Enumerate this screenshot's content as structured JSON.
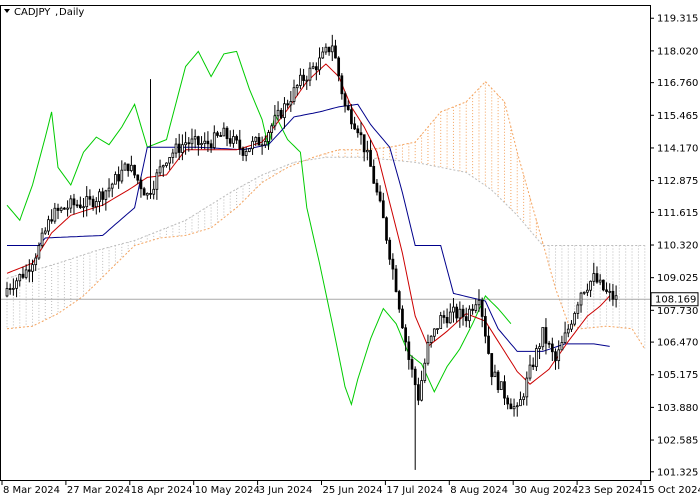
{
  "symbol": "CADJPY",
  "timeframe": "Daily",
  "current_price_label": "108.169",
  "chart_data": {
    "type": "candlestick",
    "symbol": "CADJPY",
    "timeframe": "Daily",
    "indicator": "Ichimoku Kinko Hyo",
    "ylim": [
      101.0,
      119.8
    ],
    "y_ticks": [
      "119.315",
      "118.020",
      "116.760",
      "115.465",
      "114.170",
      "112.875",
      "111.615",
      "110.320",
      "109.025",
      "107.730",
      "106.470",
      "105.175",
      "103.880",
      "102.585",
      "101.325"
    ],
    "y_tick_values": [
      119.315,
      118.02,
      116.76,
      115.465,
      114.17,
      112.875,
      111.615,
      110.32,
      109.025,
      107.73,
      106.47,
      105.175,
      103.88,
      102.585,
      101.325
    ],
    "x_ticks": [
      "8 Mar 2024",
      "27 Mar 2024",
      "18 Apr 2024",
      "10 May 2024",
      "3 Jun 2024",
      "25 Jun 2024",
      "17 Jul 2024",
      "8 Aug 2024",
      "30 Aug 2024",
      "23 Sep 2024",
      "15 Oct 2024"
    ],
    "current_price": 108.169,
    "series": [
      {
        "name": "Price",
        "color": "#000000"
      },
      {
        "name": "Tenkan-sen",
        "color": "#cc0000"
      },
      {
        "name": "Kijun-sen",
        "color": "#00008b"
      },
      {
        "name": "Chikou Span",
        "color": "#00cc00"
      },
      {
        "name": "Senkou Span A",
        "color": "#f4a460"
      },
      {
        "name": "Senkou Span B",
        "color": "#c0c0c0"
      }
    ],
    "close_keypoints": [
      [
        0,
        108.6
      ],
      [
        6,
        109.3
      ],
      [
        10,
        110.2
      ],
      [
        14,
        111.5
      ],
      [
        20,
        111.9
      ],
      [
        26,
        112.0
      ],
      [
        32,
        112.6
      ],
      [
        38,
        113.5
      ],
      [
        44,
        112.3
      ],
      [
        50,
        113.8
      ],
      [
        56,
        114.4
      ],
      [
        62,
        114.3
      ],
      [
        68,
        114.7
      ],
      [
        74,
        114.1
      ],
      [
        80,
        114.5
      ],
      [
        86,
        115.6
      ],
      [
        92,
        116.8
      ],
      [
        98,
        117.6
      ],
      [
        102,
        118.3
      ],
      [
        106,
        115.8
      ],
      [
        110,
        115.0
      ],
      [
        114,
        113.4
      ],
      [
        118,
        111.3
      ],
      [
        122,
        108.7
      ],
      [
        126,
        105.8
      ],
      [
        129,
        104.3
      ],
      [
        132,
        106.3
      ],
      [
        136,
        107.4
      ],
      [
        140,
        107.6
      ],
      [
        144,
        107.5
      ],
      [
        148,
        108.4
      ],
      [
        152,
        105.3
      ],
      [
        156,
        104.4
      ],
      [
        160,
        103.7
      ],
      [
        164,
        105.3
      ],
      [
        168,
        106.8
      ],
      [
        172,
        105.7
      ],
      [
        176,
        107.0
      ],
      [
        180,
        108.5
      ],
      [
        184,
        109.0
      ],
      [
        188,
        108.4
      ],
      [
        191,
        108.17
      ]
    ],
    "kijun_keypoints": [
      [
        0,
        110.3
      ],
      [
        10,
        110.3
      ],
      [
        12,
        110.6
      ],
      [
        30,
        110.7
      ],
      [
        40,
        111.8
      ],
      [
        44,
        114.2
      ],
      [
        60,
        114.2
      ],
      [
        74,
        114.1
      ],
      [
        82,
        114.3
      ],
      [
        90,
        115.4
      ],
      [
        98,
        115.6
      ],
      [
        104,
        115.8
      ],
      [
        110,
        115.9
      ],
      [
        114,
        115.1
      ],
      [
        120,
        114.2
      ],
      [
        124,
        112.4
      ],
      [
        128,
        110.3
      ],
      [
        136,
        110.3
      ],
      [
        140,
        108.4
      ],
      [
        150,
        108.1
      ],
      [
        154,
        107.0
      ],
      [
        160,
        106.1
      ],
      [
        168,
        106.1
      ],
      [
        175,
        106.4
      ],
      [
        184,
        106.4
      ],
      [
        189,
        106.3
      ]
    ],
    "tenkan_keypoints": [
      [
        0,
        109.2
      ],
      [
        8,
        109.6
      ],
      [
        14,
        110.8
      ],
      [
        20,
        111.5
      ],
      [
        30,
        111.9
      ],
      [
        38,
        112.5
      ],
      [
        44,
        113.0
      ],
      [
        50,
        113.1
      ],
      [
        56,
        114.1
      ],
      [
        64,
        114.1
      ],
      [
        72,
        114.1
      ],
      [
        80,
        114.4
      ],
      [
        88,
        115.7
      ],
      [
        94,
        116.8
      ],
      [
        100,
        117.5
      ],
      [
        104,
        117.0
      ],
      [
        108,
        115.8
      ],
      [
        112,
        115.0
      ],
      [
        116,
        114.0
      ],
      [
        120,
        112.0
      ],
      [
        124,
        110.0
      ],
      [
        128,
        107.5
      ],
      [
        132,
        106.3
      ],
      [
        138,
        106.9
      ],
      [
        144,
        107.6
      ],
      [
        150,
        107.3
      ],
      [
        154,
        106.5
      ],
      [
        160,
        105.3
      ],
      [
        164,
        104.8
      ],
      [
        170,
        105.4
      ],
      [
        176,
        106.5
      ],
      [
        182,
        107.5
      ],
      [
        186,
        107.9
      ],
      [
        189,
        108.3
      ]
    ],
    "chikou_keypoints": [
      [
        0,
        111.9
      ],
      [
        4,
        111.3
      ],
      [
        8,
        112.7
      ],
      [
        12,
        114.6
      ],
      [
        14,
        115.6
      ],
      [
        16,
        113.4
      ],
      [
        20,
        112.7
      ],
      [
        24,
        114.0
      ],
      [
        28,
        114.6
      ],
      [
        32,
        114.3
      ],
      [
        36,
        115.0
      ],
      [
        40,
        115.9
      ],
      [
        44,
        114.2
      ],
      [
        50,
        114.5
      ],
      [
        56,
        117.4
      ],
      [
        60,
        118.0
      ],
      [
        64,
        117.0
      ],
      [
        68,
        117.9
      ],
      [
        72,
        118.0
      ],
      [
        76,
        116.5
      ],
      [
        80,
        115.3
      ],
      [
        82,
        114.2
      ],
      [
        84,
        115.5
      ],
      [
        88,
        114.5
      ],
      [
        92,
        114.0
      ],
      [
        94,
        111.8
      ],
      [
        98,
        109.6
      ],
      [
        102,
        107.2
      ],
      [
        106,
        104.7
      ],
      [
        108,
        104.0
      ],
      [
        110,
        105.0
      ],
      [
        114,
        106.6
      ],
      [
        118,
        107.8
      ],
      [
        122,
        107.2
      ],
      [
        126,
        106.0
      ],
      [
        130,
        105.6
      ],
      [
        134,
        104.5
      ],
      [
        138,
        105.5
      ],
      [
        142,
        106.2
      ],
      [
        146,
        107.2
      ],
      [
        150,
        108.3
      ],
      [
        154,
        107.8
      ],
      [
        158,
        107.2
      ]
    ],
    "span_a_keypoints": [
      [
        0,
        107.0
      ],
      [
        8,
        107.1
      ],
      [
        16,
        107.6
      ],
      [
        24,
        108.3
      ],
      [
        32,
        109.3
      ],
      [
        40,
        110.3
      ],
      [
        48,
        110.6
      ],
      [
        56,
        110.7
      ],
      [
        64,
        111.0
      ],
      [
        72,
        111.8
      ],
      [
        80,
        112.8
      ],
      [
        88,
        113.4
      ],
      [
        96,
        113.8
      ],
      [
        104,
        114.1
      ],
      [
        112,
        114.1
      ],
      [
        120,
        114.2
      ],
      [
        128,
        114.4
      ],
      [
        136,
        115.6
      ],
      [
        144,
        116.0
      ],
      [
        150,
        116.8
      ],
      [
        156,
        116.0
      ],
      [
        160,
        114.0
      ],
      [
        164,
        112.2
      ],
      [
        168,
        110.4
      ],
      [
        172,
        108.6
      ],
      [
        176,
        107.2
      ],
      [
        180,
        107.0
      ],
      [
        188,
        107.1
      ],
      [
        196,
        107.0
      ],
      [
        200,
        106.2
      ]
    ],
    "span_b_keypoints": [
      [
        0,
        109.0
      ],
      [
        16,
        109.6
      ],
      [
        28,
        110.1
      ],
      [
        40,
        110.5
      ],
      [
        56,
        111.3
      ],
      [
        70,
        112.4
      ],
      [
        80,
        113.1
      ],
      [
        90,
        113.6
      ],
      [
        100,
        113.8
      ],
      [
        112,
        113.8
      ],
      [
        120,
        113.7
      ],
      [
        128,
        113.6
      ],
      [
        136,
        113.4
      ],
      [
        144,
        113.2
      ],
      [
        152,
        112.5
      ],
      [
        160,
        111.5
      ],
      [
        168,
        110.3
      ],
      [
        176,
        110.3
      ],
      [
        184,
        110.3
      ],
      [
        192,
        110.3
      ],
      [
        200,
        110.3
      ]
    ]
  }
}
